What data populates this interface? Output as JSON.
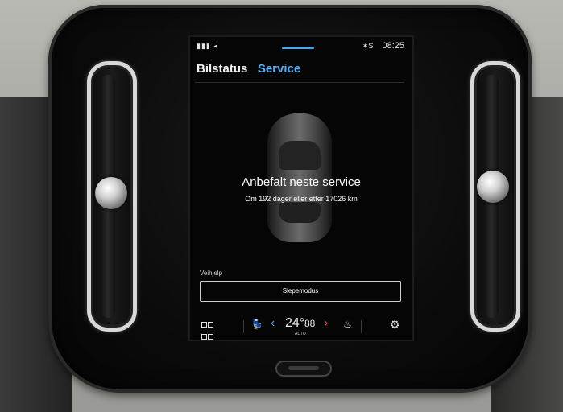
{
  "statusbar": {
    "signal": "▮▮▮ ◂",
    "bt": "✶S",
    "time": "08:25"
  },
  "tabs": [
    {
      "label": "Bilstatus",
      "active": false
    },
    {
      "label": "Service",
      "active": true
    }
  ],
  "service": {
    "title": "Anbefalt neste service",
    "subtitle": "Om 192 dager eller etter 17026 km"
  },
  "assistance": {
    "section_label": "Veihjelp",
    "tow_mode_label": "Slepemodus"
  },
  "climate": {
    "apps_icon": "apps-grid-icon",
    "seat_fan_icon": "seat-ventilation-icon",
    "left_arrow": "‹",
    "temperature": "24°",
    "temperature_mode": "AUTO",
    "fan_speed": "88",
    "right_arrow": "›",
    "seat_heat_icon": "seat-heat-icon",
    "settings_icon": "settings-gear-icon"
  },
  "colors": {
    "accent": "#4fb3ff",
    "temp_up": "#ff3a3a",
    "screen_bg": "#050505"
  }
}
